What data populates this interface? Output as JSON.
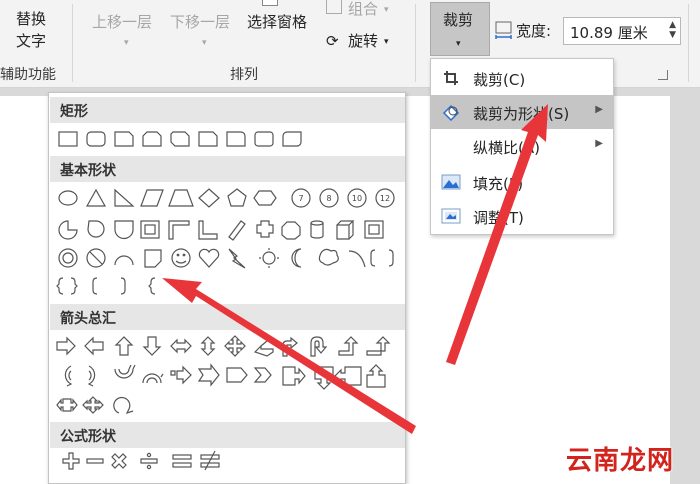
{
  "ribbon": {
    "replace_text_line1": "替换",
    "replace_text_line2": "文字",
    "accessibility_group": "辅助功能",
    "bring_forward": "上移一层",
    "send_backward": "下移一层",
    "selection_pane": "选择窗格",
    "group": "组合",
    "rotate": "旋转",
    "arrange_group": "排列",
    "crop": "裁剪",
    "width_label": "宽度:",
    "width_value": "10.89 厘米"
  },
  "gallery": {
    "categories": [
      "矩形",
      "基本形状",
      "箭头总汇",
      "公式形状"
    ],
    "octagon_numbers": [
      "7",
      "8",
      "10",
      "12"
    ]
  },
  "crop_menu": {
    "items": [
      {
        "label": "裁剪(C)",
        "icon": "crop-icon"
      },
      {
        "label": "裁剪为形状(S)",
        "icon": "crop-to-shape-icon",
        "submenu": true,
        "highlighted": true
      },
      {
        "label": "纵横比(A)",
        "icon": "",
        "submenu": true
      },
      {
        "label": "填充(L)",
        "icon": "fill-icon"
      },
      {
        "label": "调整(T)",
        "icon": "fit-icon"
      }
    ]
  },
  "watermark": "云南龙网",
  "colors": {
    "arrow_red": "#e8353a",
    "highlight": "#c5c5c5",
    "category_bg": "#e6e6e6"
  }
}
